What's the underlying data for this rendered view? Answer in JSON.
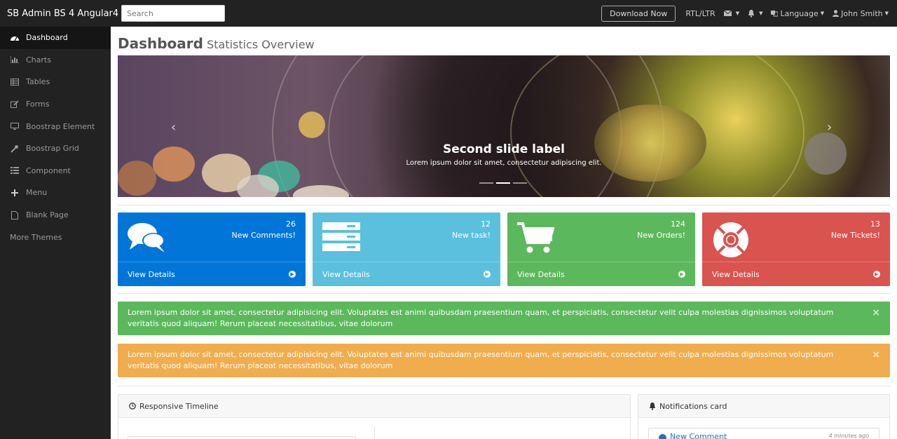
{
  "app": {
    "brand": "SB Admin BS 4 Angular4"
  },
  "topnav": {
    "search_placeholder": "Search",
    "download_label": "Download Now",
    "rtl_label": "RTL/LTR",
    "language_label": "Language",
    "user_label": "John Smith"
  },
  "sidebar": {
    "items": [
      {
        "label": "Dashboard",
        "icon": "dashboard-icon"
      },
      {
        "label": "Charts",
        "icon": "bar-chart-icon"
      },
      {
        "label": "Tables",
        "icon": "table-icon"
      },
      {
        "label": "Forms",
        "icon": "edit-icon"
      },
      {
        "label": "Boostrap Element",
        "icon": "desktop-icon"
      },
      {
        "label": "Boostrap Grid",
        "icon": "wrench-icon"
      },
      {
        "label": "Component",
        "icon": "list-icon"
      },
      {
        "label": "Menu",
        "icon": "plus-icon"
      },
      {
        "label": "Blank Page",
        "icon": "file-icon"
      },
      {
        "label": "More Themes",
        "icon": ""
      }
    ]
  },
  "page": {
    "title": "Dashboard",
    "subtitle": "Statistics Overview"
  },
  "carousel": {
    "caption_title": "Second slide label",
    "caption_text": "Lorem ipsum dolor sit amet, consectetur adipiscing elit.",
    "prev": "‹",
    "next": "›"
  },
  "cards": [
    {
      "count": "26",
      "label": "New Comments!",
      "footer": "View Details",
      "color": "#0275d8",
      "icon": "comments-icon"
    },
    {
      "count": "12",
      "label": "New task!",
      "footer": "View Details",
      "color": "#5bc0de",
      "icon": "tasks-icon"
    },
    {
      "count": "124",
      "label": "New Orders!",
      "footer": "View Details",
      "color": "#5cb85c",
      "icon": "shopping-cart-icon"
    },
    {
      "count": "13",
      "label": "New Tickets!",
      "footer": "View Details",
      "color": "#d9534f",
      "icon": "life-ring-icon"
    }
  ],
  "alerts": [
    {
      "text": "Lorem ipsum dolor sit amet, consectetur adipisicing elit. Voluptates est animi quibusdam praesentium quam, et perspiciatis, consectetur velit culpa molestias dignissimos voluptatum veritatis quod aliquam! Rerum placeat necessitatibus, vitae dolorum",
      "color": "#5cb85c",
      "close": "×"
    },
    {
      "text": "Lorem ipsum dolor sit amet, consectetur adipisicing elit. Voluptates est animi quibusdam praesentium quam, et perspiciatis, consectetur velit culpa molestias dignissimos voluptatum veritatis quod aliquam! Rerum placeat necessitatibus, vitae dolorum",
      "color": "#f0ad4e",
      "close": "×"
    }
  ],
  "panels": {
    "timeline_title": "Responsive Timeline",
    "notifications_title": "Notifications card",
    "notification_item": {
      "label": "New Comment",
      "time": "4 minutes ago"
    }
  }
}
